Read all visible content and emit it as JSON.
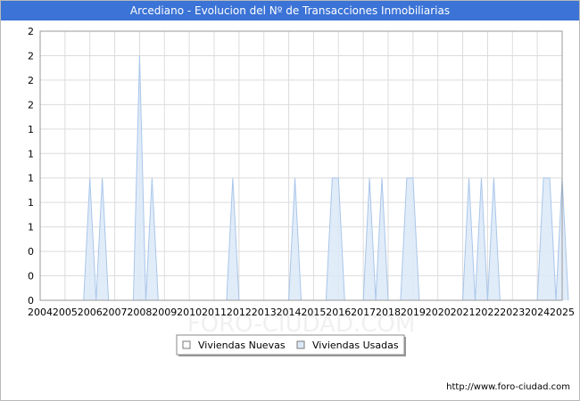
{
  "chart_data": {
    "type": "area",
    "title": "Arcediano - Evolucion del Nº de Transacciones Inmobiliarias",
    "xlabel": "",
    "ylabel": "",
    "x_tick_labels": [
      "2004",
      "2005",
      "2006",
      "2007",
      "2008",
      "2009",
      "2010",
      "2011",
      "2012",
      "2013",
      "2014",
      "2015",
      "2016",
      "2017",
      "2018",
      "2019",
      "2020",
      "2021",
      "2022",
      "2023",
      "2024",
      "2025"
    ],
    "y_tick_labels": [
      "0",
      "0",
      "0",
      "1",
      "1",
      "1",
      "1",
      "1",
      "2",
      "2",
      "2",
      "2"
    ],
    "ylim": [
      0,
      2.2
    ],
    "xlim": [
      2004,
      2025
    ],
    "grid": true,
    "legend_position": "bottom",
    "series": [
      {
        "name": "Viviendas Nuevas",
        "color": "#ffffff",
        "x": [],
        "y": []
      },
      {
        "name": "Viviendas Usadas",
        "color": "#dce9f8",
        "line_color": "#a9c6ea",
        "x": [
          2005.75,
          2006.0,
          2006.25,
          2006.5,
          2006.75,
          2007.75,
          2008.0,
          2008.25,
          2008.5,
          2008.75,
          2011.5,
          2011.75,
          2012.0,
          2014.0,
          2014.25,
          2014.5,
          2015.5,
          2015.75,
          2016.0,
          2016.25,
          2016.5,
          2017.0,
          2017.25,
          2017.5,
          2017.75,
          2018.0,
          2018.5,
          2018.75,
          2019.0,
          2019.25,
          2021.0,
          2021.25,
          2021.5,
          2021.75,
          2022.0,
          2022.25,
          2022.5,
          2024.0,
          2024.25,
          2024.5,
          2024.75,
          2025.0,
          2025.25
        ],
        "y": [
          0,
          1,
          0,
          1,
          0,
          0,
          2,
          0,
          1,
          0,
          0,
          1,
          0,
          0,
          1,
          0,
          0,
          1,
          1,
          0,
          0,
          0,
          1,
          0,
          1,
          0,
          0,
          1,
          1,
          0,
          0,
          1,
          0,
          1,
          0,
          1,
          0,
          0,
          1,
          1,
          0,
          1,
          0
        ]
      }
    ]
  },
  "footer": {
    "url": "http://www.foro-ciudad.com"
  },
  "watermark": {
    "text": "FORO-CIUDAD.COM"
  }
}
